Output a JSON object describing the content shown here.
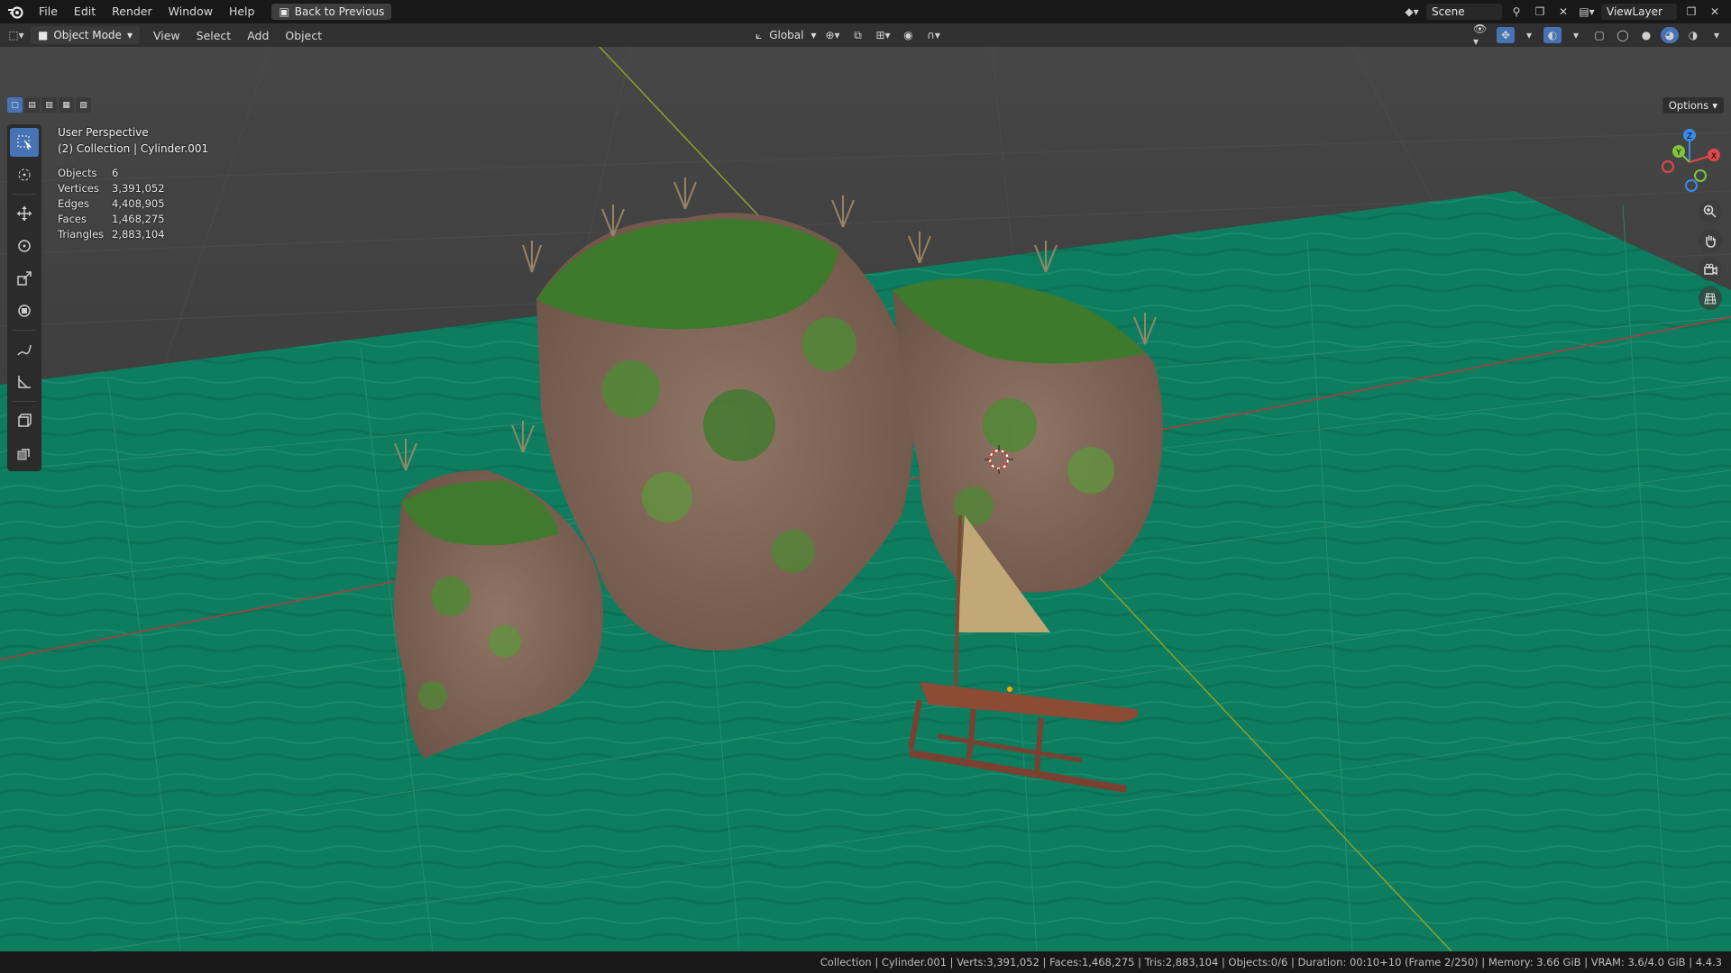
{
  "menu": [
    "File",
    "Edit",
    "Render",
    "Window",
    "Help"
  ],
  "back_button": "Back to Previous",
  "scene_name": "Scene",
  "view_layer": "ViewLayer",
  "header": {
    "mode": "Object Mode",
    "menus": [
      "View",
      "Select",
      "Add",
      "Object"
    ],
    "orientation": "Global"
  },
  "options_label": "Options",
  "overlay": {
    "perspective": "User Perspective",
    "collection": "(2) Collection | Cylinder.001"
  },
  "stats": [
    {
      "label": "Objects",
      "value": "6"
    },
    {
      "label": "Vertices",
      "value": "3,391,052"
    },
    {
      "label": "Edges",
      "value": "4,408,905"
    },
    {
      "label": "Faces",
      "value": "1,468,275"
    },
    {
      "label": "Triangles",
      "value": "2,883,104"
    }
  ],
  "gizmo": {
    "x": "X",
    "y": "Y",
    "z": "Z",
    "x_color": "#e04747",
    "y_color": "#7fc43c",
    "z_color": "#3a8be8"
  },
  "status_bar": "Collection | Cylinder.001 | Verts:3,391,052 | Faces:1,468,275 | Tris:2,883,104 | Objects:0/6 | Duration: 00:10+10 (Frame 2/250) | Memory: 3.66 GiB | VRAM: 3.6/4.0 GiB | 4.4.3",
  "colors": {
    "accent": "#4772b3",
    "water": "#0c7a5e",
    "grid_bg": "#3c3c3c"
  }
}
